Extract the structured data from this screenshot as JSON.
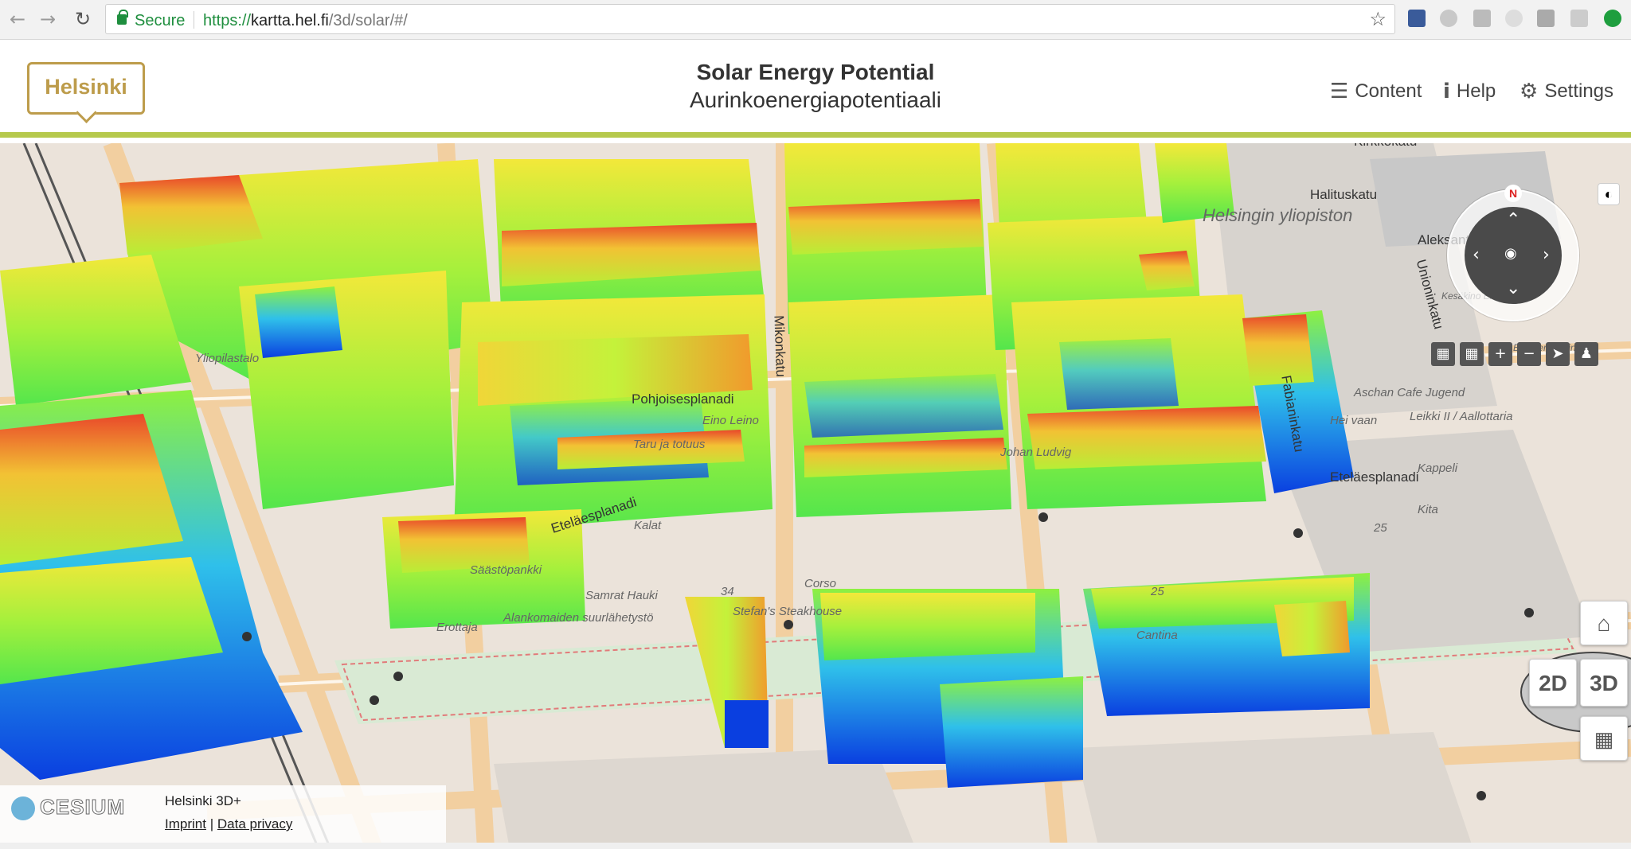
{
  "browser": {
    "secure_label": "Secure",
    "url_scheme": "https://",
    "url_host": "kartta.hel.fi",
    "url_path": "/3d/solar/#/"
  },
  "header": {
    "logo_text": "Helsinki",
    "title_en": "Solar Energy Potential",
    "title_fi": "Aurinkoenergiapotentiaali",
    "menu": {
      "content": "Content",
      "help": "Help",
      "settings": "Settings"
    }
  },
  "map": {
    "streets": [
      "Pohjoisesplanadi",
      "Eteläesplanadi",
      "Eteläesplanadi",
      "Mikonkatu",
      "Fabianinkatu",
      "Unioninkatu",
      "Kirkkokatu",
      "Halituskatu",
      "Aleksanterinkatu"
    ],
    "places": [
      "Helsingin yliopiston",
      "Eino Leino",
      "Taru ja totuus",
      "Johan Ludvig",
      "Hei vaan",
      "Leikki II / Aallottaria",
      "Kappeli",
      "Erottaja",
      "Kalat",
      "Säästöpankki",
      "Samrat Hauki",
      "Stefan's Steakhouse",
      "Corso",
      "Alankomaiden suurlähetystö",
      "Cantina",
      "Aschan Cafe Jugend",
      "Kita",
      "Yliopilastalo",
      "Kesäkino Engel",
      "Brygger Helsinki"
    ],
    "numbers": [
      "34",
      "25",
      "25"
    ],
    "compass_north": "N"
  },
  "controls": {
    "btn_2d": "2D",
    "btn_3d": "3D"
  },
  "footer": {
    "logo": "CESIUM",
    "app_name": "Helsinki 3D+",
    "imprint": "Imprint",
    "separator": "|",
    "privacy": "Data privacy"
  },
  "icons": [
    "back-icon",
    "forward-icon",
    "reload-icon",
    "lock-icon",
    "star-icon",
    "hamburger-icon",
    "info-icon",
    "gear-icon",
    "home-icon",
    "grid-icon",
    "contrast-icon"
  ]
}
